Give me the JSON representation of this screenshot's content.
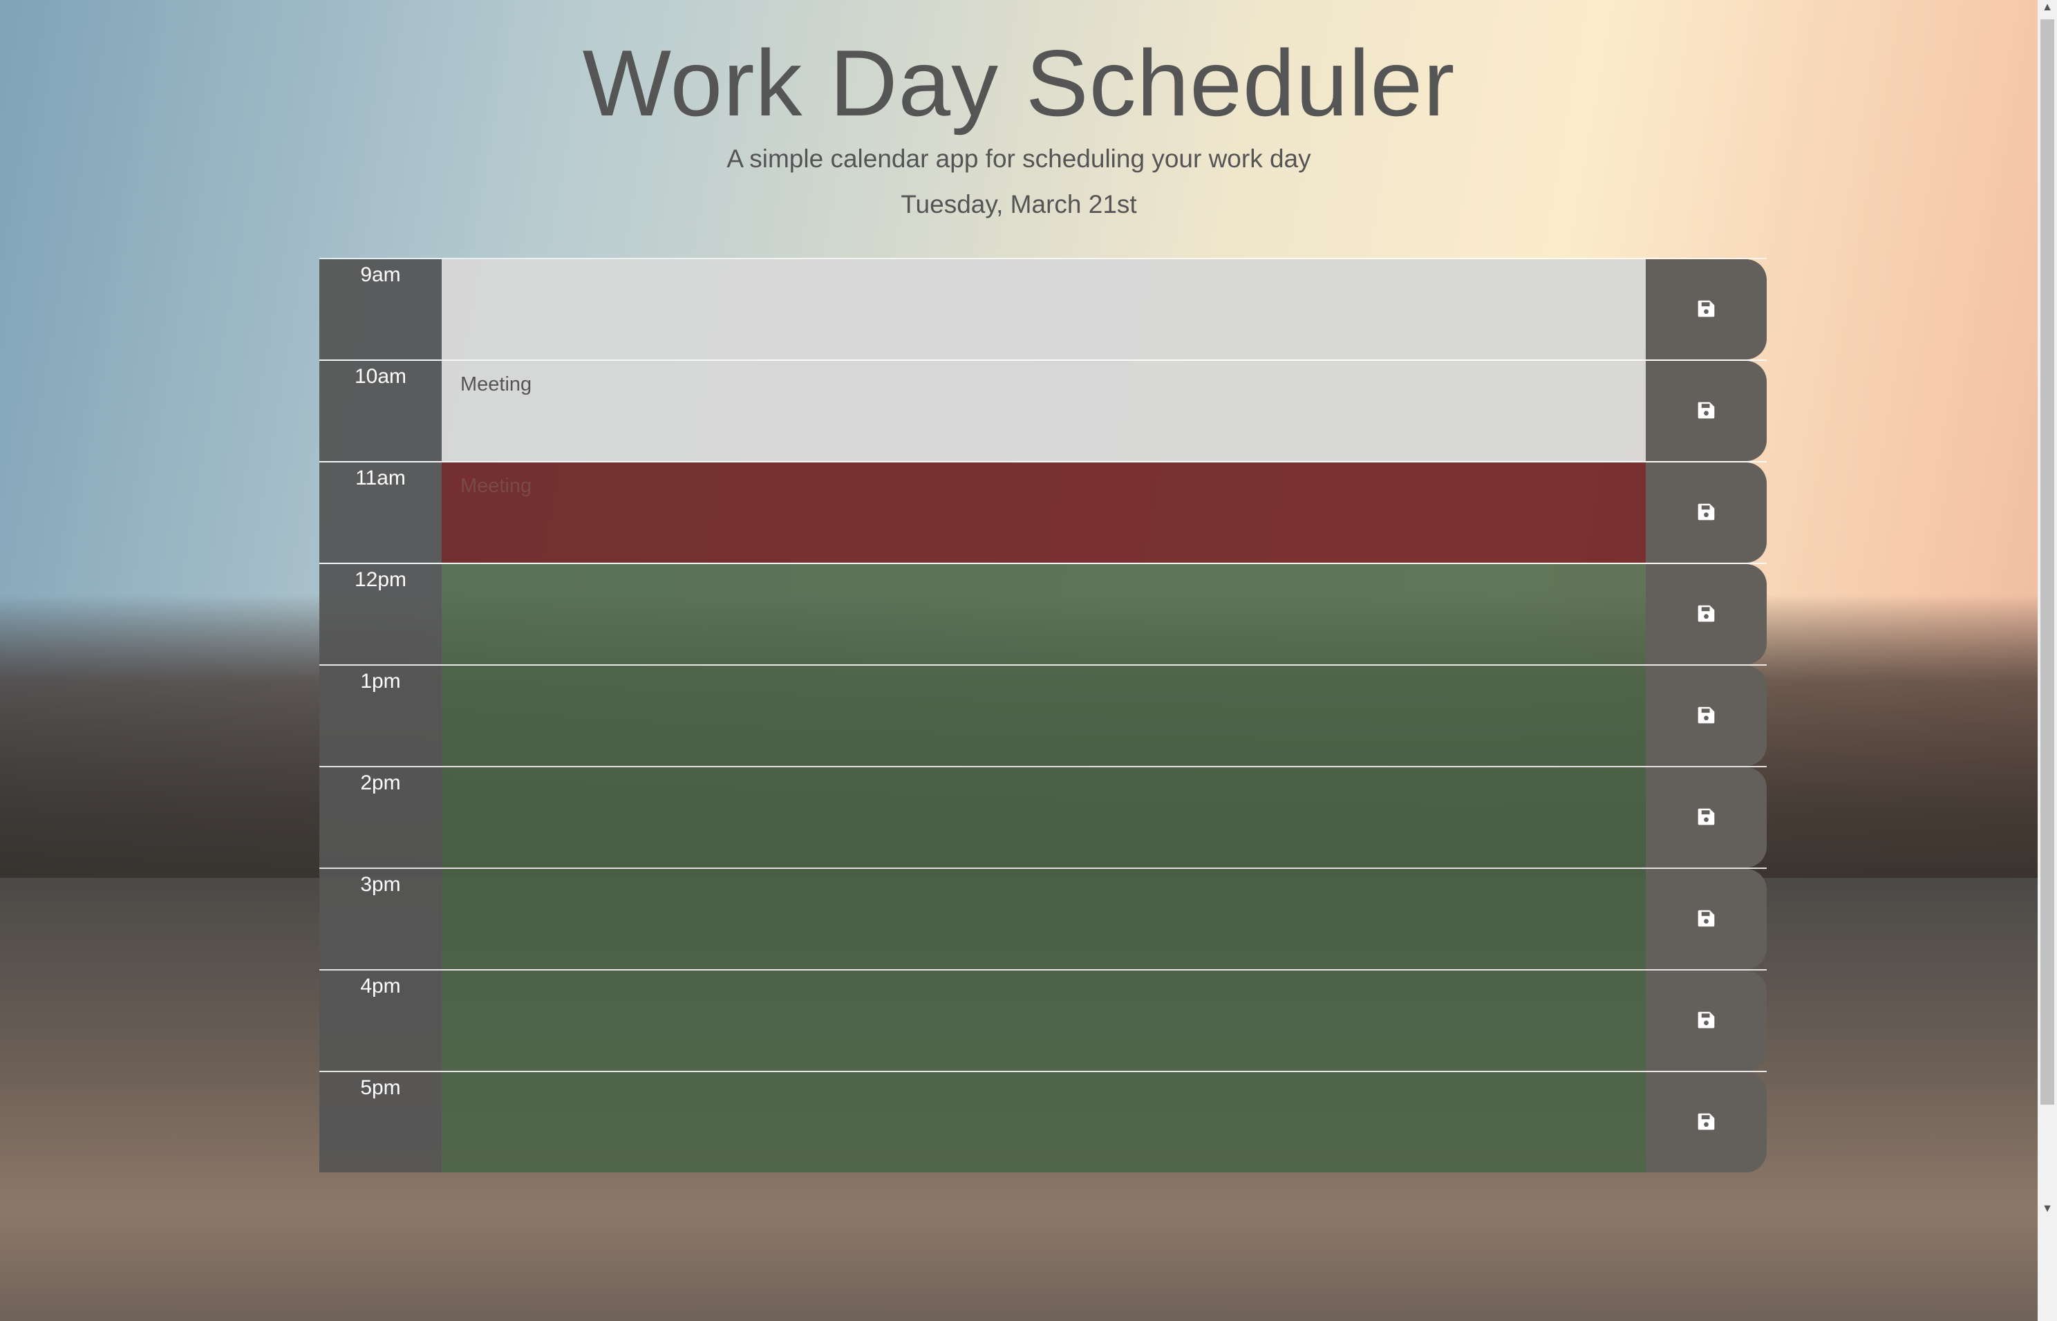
{
  "header": {
    "title": "Work Day Scheduler",
    "subtitle": "A simple calendar app for scheduling your work day",
    "date": "Tuesday, March 21st"
  },
  "colors": {
    "past": "#d7d7d7",
    "present": "#6f2323",
    "future": "#4b6448",
    "save_button": "#63605c"
  },
  "rows": [
    {
      "hour": "9am",
      "text": "",
      "state": "past"
    },
    {
      "hour": "10am",
      "text": "Meeting",
      "state": "past"
    },
    {
      "hour": "11am",
      "text": "Meeting",
      "state": "present"
    },
    {
      "hour": "12pm",
      "text": "",
      "state": "future"
    },
    {
      "hour": "1pm",
      "text": "",
      "state": "future"
    },
    {
      "hour": "2pm",
      "text": "",
      "state": "future"
    },
    {
      "hour": "3pm",
      "text": "",
      "state": "future"
    },
    {
      "hour": "4pm",
      "text": "",
      "state": "future"
    },
    {
      "hour": "5pm",
      "text": "",
      "state": "future"
    }
  ],
  "icons": {
    "save": "floppy-disk-icon"
  }
}
